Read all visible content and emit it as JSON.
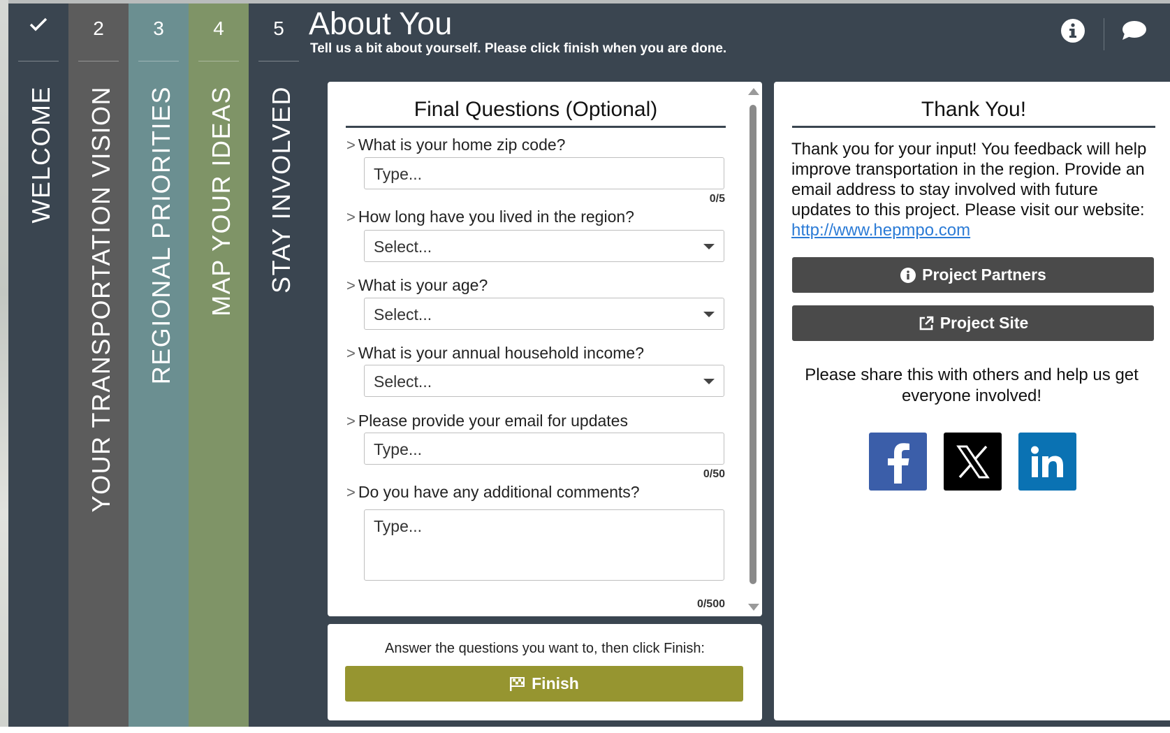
{
  "steps": [
    {
      "num": "",
      "label": "WELCOME",
      "completed": true
    },
    {
      "num": "2",
      "label": "YOUR TRANSPORTATION VISION"
    },
    {
      "num": "3",
      "label": "REGIONAL PRIORITIES"
    },
    {
      "num": "4",
      "label": "MAP YOUR IDEAS"
    },
    {
      "num": "5",
      "label": "STAY INVOLVED"
    }
  ],
  "header": {
    "title": "About You",
    "subtitle": "Tell us a bit about yourself. Please click finish when you are done.",
    "icons": [
      "info-icon",
      "comment-icon"
    ]
  },
  "questions": {
    "title": "Final Questions (Optional)",
    "items": [
      {
        "label": "What is your home zip code?",
        "type": "text",
        "placeholder": "Type...",
        "counter": "0/5"
      },
      {
        "label": "How long have you lived in the region?",
        "type": "select",
        "value": "Select..."
      },
      {
        "label": "What is your age?",
        "type": "select",
        "value": "Select..."
      },
      {
        "label": "What is your annual household income?",
        "type": "select",
        "value": "Select..."
      },
      {
        "label": "Please provide your email for updates",
        "type": "text",
        "placeholder": "Type...",
        "counter": "0/50"
      },
      {
        "label": "Do you have any additional comments?",
        "type": "textarea",
        "placeholder": "Type...",
        "counter": "0/500"
      }
    ]
  },
  "finish": {
    "prompt": "Answer the questions you want to, then click Finish:",
    "button_label": "Finish",
    "button_color": "#969530"
  },
  "thanks": {
    "title": "Thank You!",
    "body": "Thank you for your input! You feedback will help improve transportation in the region. Provide an email address to stay involved with future updates to this project. Please visit our website:",
    "link": " http://www.hepmpo.com",
    "partners_button": "Project Partners",
    "site_button": "Project Site",
    "share_text": "Please share this with others and help us get everyone involved!",
    "social": [
      "facebook-icon",
      "x-icon",
      "linkedin-icon"
    ]
  },
  "colors": {
    "panel": "#3a4550",
    "step2": "#5c5c5c",
    "step3": "#6b8f91",
    "step4": "#7f9467",
    "link": "#2b7bd6"
  }
}
